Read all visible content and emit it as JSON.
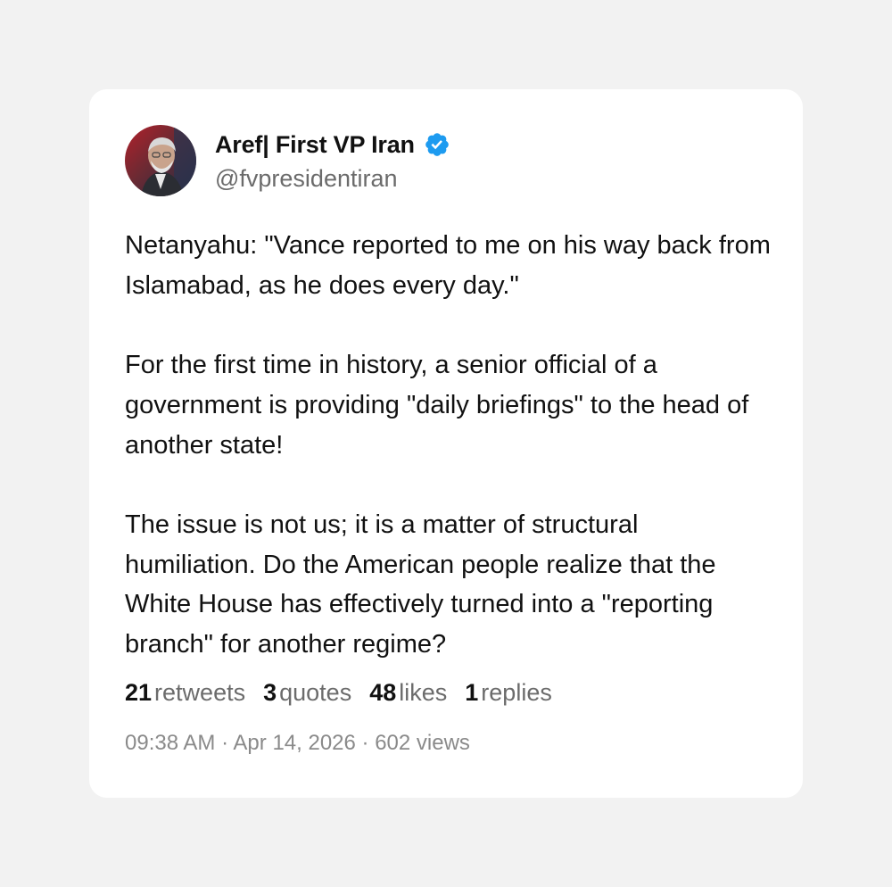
{
  "author": {
    "display_name": "Aref| First VP Iran",
    "handle": "@fvpresidentiran",
    "verified": true,
    "avatar_icon": "portrait-avatar",
    "verified_icon": "verified-badge-icon",
    "verified_color": "#1d9bf0"
  },
  "tweet": {
    "paragraphs": [
      "Netanyahu: \"Vance reported to me on his way back from Islamabad, as he does every day.\"",
      "For the first time in history, a senior official of a government is providing \"daily briefings\" to the head of another state!",
      "The issue is not us; it is a matter of structural humiliation. Do the American people realize that the White House has effectively turned into a \"reporting branch\" for another regime?"
    ]
  },
  "stats": {
    "retweets_count": "21",
    "retweets_label": "retweets",
    "quotes_count": "3",
    "quotes_label": "quotes",
    "likes_count": "48",
    "likes_label": "likes",
    "replies_count": "1",
    "replies_label": "replies"
  },
  "meta": {
    "time": "09:38 AM",
    "date": "Apr 14, 2026",
    "views": "602 views",
    "separator": " · "
  },
  "colors": {
    "page_background": "#f2f2f2",
    "card_background": "#ffffff",
    "text_primary": "#111111",
    "text_secondary": "#6b6b6b"
  }
}
